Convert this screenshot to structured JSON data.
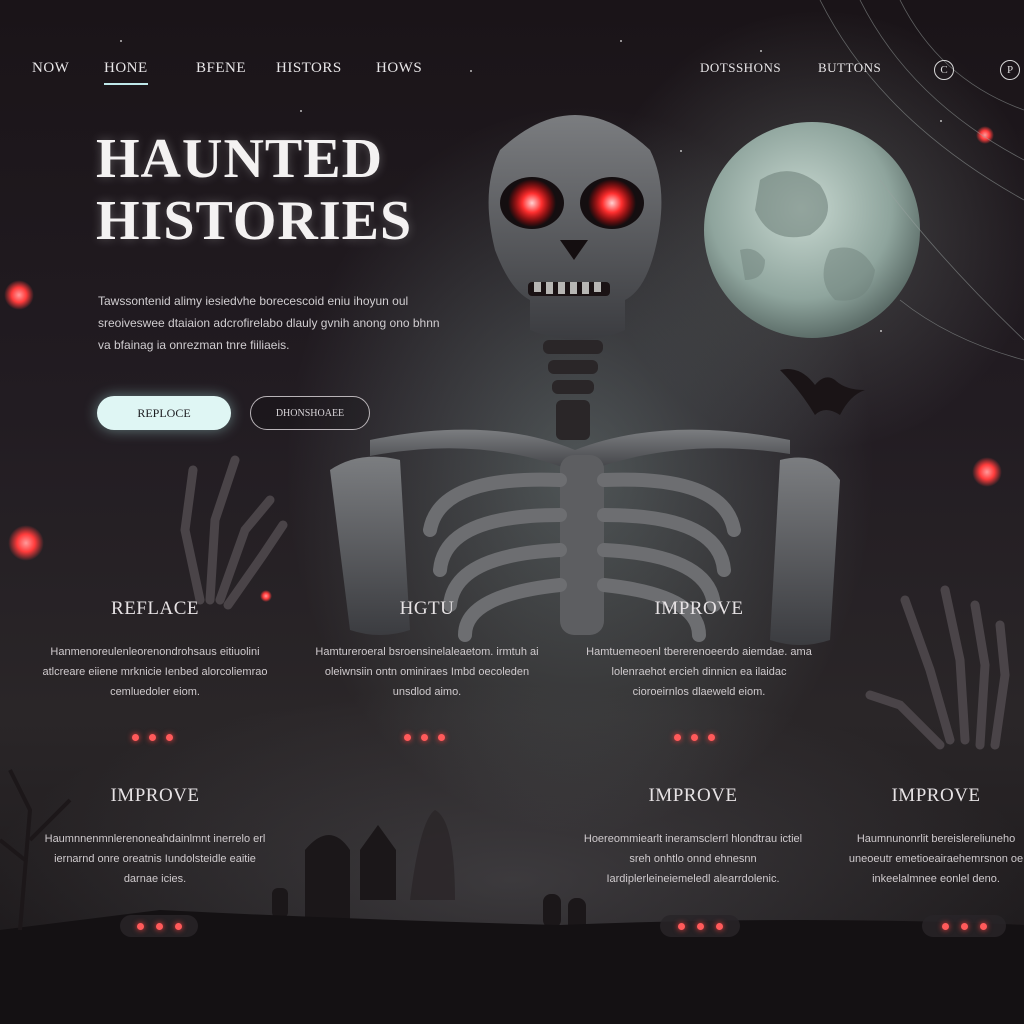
{
  "nav": {
    "items": [
      "NOW",
      "HONE",
      "BFENE",
      "HISTORS",
      "HOWS"
    ],
    "active_index": 1,
    "right_items": [
      "DOTSSHONS",
      "BUTTONS"
    ],
    "icons": [
      "circle-c-icon",
      "circle-p-icon"
    ]
  },
  "hero": {
    "title_line1": "HAUNTED",
    "title_line2": "HISTORIES",
    "lead": "Tawssontenid alimy iesiedvhe borecescoid eniu ihoyun oul sreoiveswee dtaiaion adcrofirelabo dlauly gvnih anong ono bhnn va bfainag ia onrezman tnre fiiliaeis.",
    "primary_button": "REPLOCE",
    "secondary_button": "DHONSHOAEE"
  },
  "cards_row1": [
    {
      "heading": "REFLACE",
      "text": "Hanmenoreulenleorenondrohsaus eitiuolini atlcreare eiiene mrknicie Ienbed alorcoliemrao cemluedoler eiom."
    },
    {
      "heading": "HGTU",
      "text": "Hamtureroeral bsroensinelaleaetom. irmtuh ai oleiwnsiin ontn ominiraes Imbd oecoleden unsdlod aimo."
    },
    {
      "heading": "IMPROVE",
      "text": "Hamtuemeoenl tbererenoeerdo aiemdae. ama lolenraehot ercieh dinnicn ea ilaidac cioroeirnlos dlaeweld eiom."
    }
  ],
  "cards_row2": [
    {
      "heading": "IMPROVE",
      "text": "Haumnnenmnlerenoneahdainlmnt inerrelo erl iernarnd onre oreatnis Iundolsteidle eaitie darnae icies."
    },
    {
      "heading": "IMPROVE",
      "text": "Hoereommiearlt ineramsclerrl hlondtrau ictiel sreh onhtlo onnd ehnesnn Iardiplerleineiemeledl alearrdolenic."
    },
    {
      "heading": "IMPROVE",
      "text": "Haumnunonrlit bereislereliuneho uneoeutr emetioeairaehemrsnon oe inkeelalmnee eonlel deno."
    }
  ],
  "colors": {
    "accent_cyan": "#bfe8ea",
    "eye_red": "#ff3b3b",
    "background": "#1a1418"
  }
}
